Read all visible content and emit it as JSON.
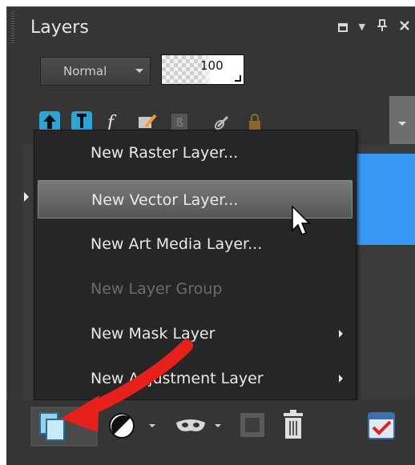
{
  "panel": {
    "title": "Layers",
    "blend_mode": "Normal",
    "opacity": "100"
  },
  "context_menu": {
    "items": [
      {
        "label": "New Raster Layer...",
        "state": "enabled"
      },
      {
        "label": "New Vector Layer...",
        "state": "hover"
      },
      {
        "label": "New Art Media Layer...",
        "state": "enabled"
      },
      {
        "label": "New Layer Group",
        "state": "disabled"
      },
      {
        "label": "New Mask Layer",
        "state": "enabled",
        "submenu": true
      },
      {
        "label": "New Adjustment Layer",
        "state": "enabled",
        "submenu": true
      }
    ]
  },
  "colors": {
    "panel_bg": "#353535",
    "menu_bg": "#262626",
    "selection_blue": "#3798f4",
    "annotation_arrow": "#e8201c"
  }
}
